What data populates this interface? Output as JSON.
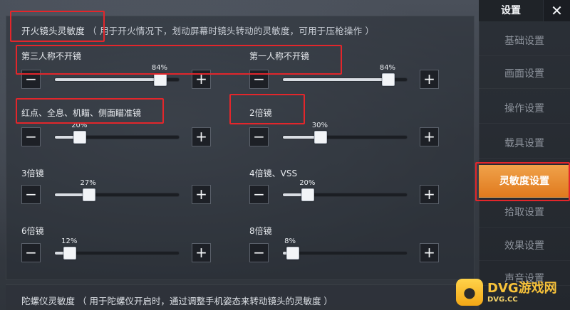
{
  "section": {
    "title": "开火镜头灵敏度",
    "subtitle": "（ 用于开火情况下，划动屏幕时镜头转动的灵敏度，可用于压枪操作 ）"
  },
  "sliders": [
    {
      "label": "第三人称不开镜",
      "value": 84,
      "pct_text": "84%"
    },
    {
      "label": "第一人称不开镜",
      "value": 84,
      "pct_text": "84%"
    },
    {
      "label": "红点、全息、机瞄、侧面瞄准镜",
      "value": 20,
      "pct_text": "20%"
    },
    {
      "label": "2倍镜",
      "value": 30,
      "pct_text": "30%"
    },
    {
      "label": "3倍镜",
      "value": 27,
      "pct_text": "27%"
    },
    {
      "label": "4倍镜、VSS",
      "value": 20,
      "pct_text": "20%"
    },
    {
      "label": "6倍镜",
      "value": 12,
      "pct_text": "12%"
    },
    {
      "label": "8倍镜",
      "value": 8,
      "pct_text": "8%"
    }
  ],
  "controls": {
    "minus": "−",
    "plus": "+"
  },
  "sidebar": {
    "title": "设置",
    "close": "✕",
    "items": [
      {
        "label": "基础设置"
      },
      {
        "label": "画面设置"
      },
      {
        "label": "操作设置"
      },
      {
        "label": "载具设置"
      },
      {
        "label": "灵敏度设置"
      },
      {
        "label": "拾取设置"
      },
      {
        "label": "效果设置"
      },
      {
        "label": "声音设置"
      }
    ],
    "active_index": 4
  },
  "bottom": {
    "text": "陀螺仪灵敏度 （ 用于陀螺仪开启时，通过调整手机姿态来转动镜头的灵敏度 ）"
  },
  "watermark": {
    "title": "DVG游戏网",
    "url": "DVG.CC",
    "logo_text": "●"
  },
  "colors": {
    "accent": "#e07a1e",
    "highlight_box": "#e3262b"
  }
}
